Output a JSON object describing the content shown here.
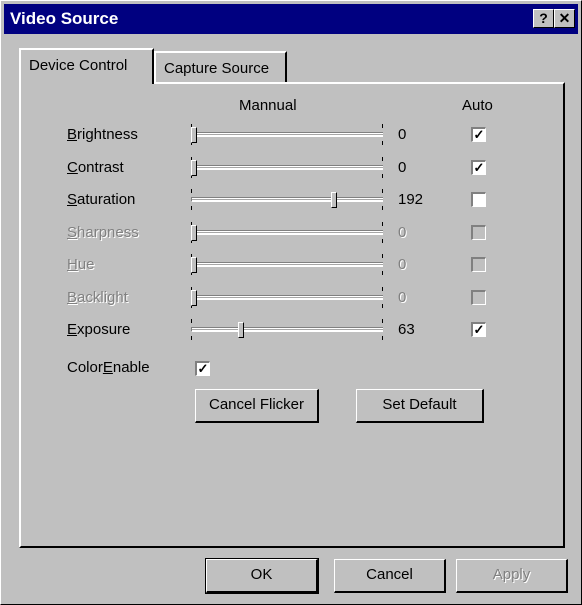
{
  "window": {
    "title": "Video Source"
  },
  "titlebar_buttons": {
    "help": "?",
    "close": "✕"
  },
  "tabs": [
    {
      "label": "Device Control",
      "active": true
    },
    {
      "label": "Capture Source",
      "active": false
    }
  ],
  "headers": {
    "manual": "Mannual",
    "auto": "Auto"
  },
  "controls": [
    {
      "label": "Brightness",
      "value": "0",
      "auto": true,
      "enabled": true,
      "slider": 0.0
    },
    {
      "label": "Contrast",
      "value": "0",
      "auto": true,
      "enabled": true,
      "slider": 0.0
    },
    {
      "label": "Saturation",
      "value": "192",
      "auto": false,
      "enabled": true,
      "slider": 0.75
    },
    {
      "label": "Sharpness",
      "value": "0",
      "auto": false,
      "enabled": false,
      "slider": 0.0
    },
    {
      "label": "Hue",
      "value": "0",
      "auto": false,
      "enabled": false,
      "slider": 0.0
    },
    {
      "label": "Backlight",
      "value": "0",
      "auto": false,
      "enabled": false,
      "slider": 0.0
    },
    {
      "label": "Exposure",
      "value": "63",
      "auto": true,
      "enabled": true,
      "slider": 0.25
    }
  ],
  "color_enable": {
    "label": "ColorEnable",
    "checked": true
  },
  "buttons": {
    "cancel_flicker": "Cancel Flicker",
    "set_default": "Set Default",
    "ok": "OK",
    "cancel": "Cancel",
    "apply": "Apply"
  }
}
